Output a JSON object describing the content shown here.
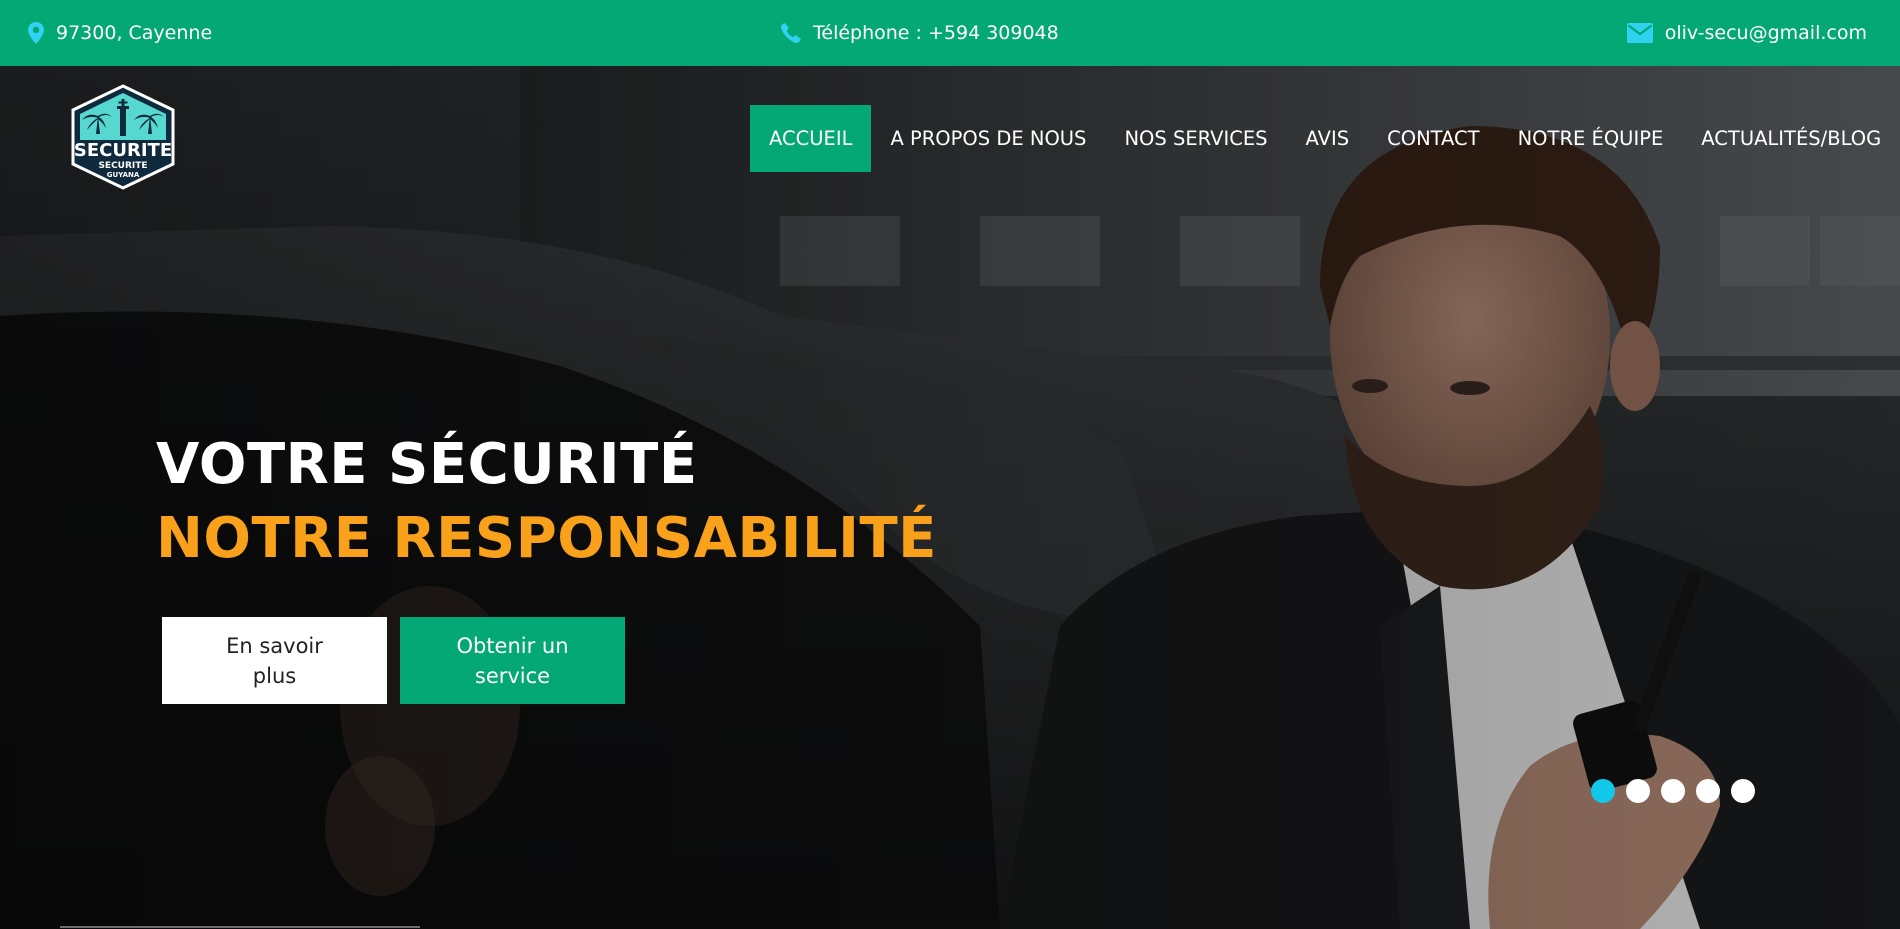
{
  "topbar": {
    "location": "97300, Cayenne",
    "phone": "Téléphone : +594 309048",
    "email": "oliv-secu@gmail.com"
  },
  "logo": {
    "line1": "SECURITE",
    "line2": "SECURITE",
    "line3": "GUYANA"
  },
  "nav": {
    "items": [
      {
        "label": "ACCUEIL",
        "active": true
      },
      {
        "label": "A PROPOS DE NOUS"
      },
      {
        "label": "NOS SERVICES"
      },
      {
        "label": "AVIS"
      },
      {
        "label": "CONTACT"
      },
      {
        "label": "NOTRE ÉQUIPE"
      },
      {
        "label": "ACTUALITÉS/BLOG"
      }
    ]
  },
  "hero": {
    "title_line1": "VOTRE SÉCURITÉ",
    "title_line2": "NOTRE RESPONSABILITÉ",
    "button_more": "En savoir plus",
    "button_service": "Obtenir un service",
    "slides_total": 5,
    "active_slide": 1
  },
  "colors": {
    "brand_green": "#03a874",
    "accent_orange": "#f9a11b",
    "active_dot": "#12c8e8",
    "icon_cyan": "#2fd3f0"
  },
  "icons": {
    "location": "map-marker-icon",
    "phone": "phone-icon",
    "email": "envelope-icon"
  }
}
